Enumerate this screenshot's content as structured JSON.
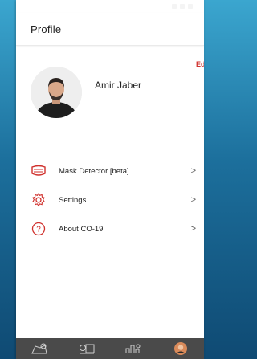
{
  "header": {
    "title": "Profile"
  },
  "profile": {
    "name": "Amir Jaber",
    "edit_label": "Edi"
  },
  "menu": {
    "items": [
      {
        "label": "Mask Detector [beta]",
        "icon": "mask-icon",
        "chevron": ">"
      },
      {
        "label": "Settings",
        "icon": "gear-icon",
        "chevron": ">"
      },
      {
        "label": "About CO-19",
        "icon": "question-icon",
        "chevron": ">"
      }
    ]
  },
  "tabbar": {
    "tabs": [
      {
        "icon": "map-pin-icon"
      },
      {
        "icon": "monitor-icon"
      },
      {
        "icon": "chart-icon"
      },
      {
        "icon": "profile-avatar-icon"
      }
    ]
  },
  "colors": {
    "accent": "#d0312d",
    "background_gradient_top": "#3ba6cf",
    "background_gradient_bottom": "#0f4a73",
    "tabbar": "#4a4a4a"
  }
}
